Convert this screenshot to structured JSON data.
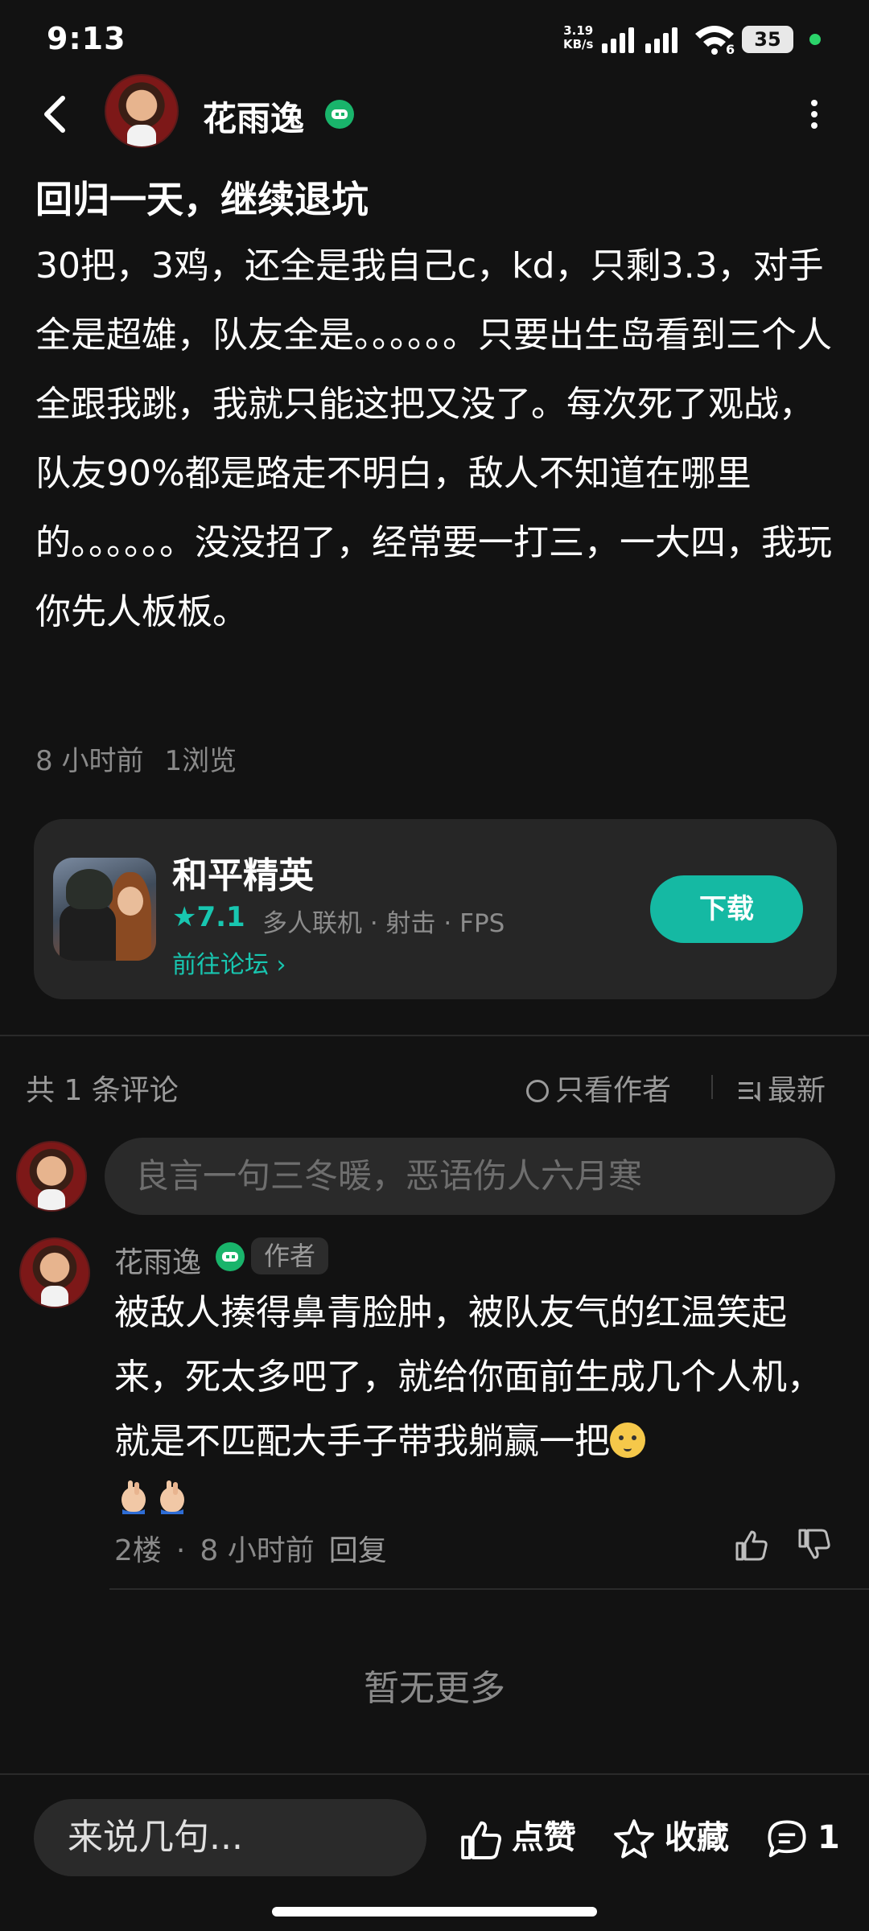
{
  "status_bar": {
    "time": "9:13",
    "net_speed_value": "3.19",
    "net_speed_unit": "KB/s",
    "wifi_label": "6",
    "battery": "35"
  },
  "header": {
    "author_name": "花雨逸"
  },
  "post": {
    "title": "回归一天，继续退坑",
    "body": "30把，3鸡，还全是我自己c，kd，只剩3.3，对手全是超雄，队友全是。。。。。。只要出生岛看到三个人全跟我跳，我就只能这把又没了。每次死了观战，队友90%都是路走不明白，敌人不知道在哪里的。。。。。。没没招了，经常要一打三，一大四，我玩你先人板板。",
    "time_ago": "8 小时前",
    "views": "1浏览"
  },
  "game_card": {
    "name": "和平精英",
    "rating": "★7.1",
    "tags": "多人联机 · 射击 · FPS",
    "forum_link": "前往论坛 ›",
    "download_label": "下载"
  },
  "comments_header": {
    "count_label": "共 1 条评论",
    "author_only_label": "只看作者",
    "sort_label": "最新"
  },
  "comment_input": {
    "placeholder": "良言一句三冬暖，恶语伤人六月寒"
  },
  "comment": {
    "name": "花雨逸",
    "author_tag": "作者",
    "text": "被敌人揍得鼻青脸肿，被队友气的红温笑起来，死太多吧了，就给你面前生成几个人机，就是不匹配大手子带我躺赢一把",
    "floor": "2楼",
    "dot": "·",
    "time_ago": "8 小时前",
    "reply_label": "回复"
  },
  "footer": {
    "no_more": "暂无更多"
  },
  "bottom_bar": {
    "input_placeholder": "来说几句...",
    "like_label": "点赞",
    "favorite_label": "收藏",
    "comment_count": "1"
  },
  "colors": {
    "background": "#121212",
    "accent_teal": "#15b9a3",
    "badge_green": "#19b46b",
    "card_bg": "#262626",
    "muted_text": "#8a8a8a"
  }
}
